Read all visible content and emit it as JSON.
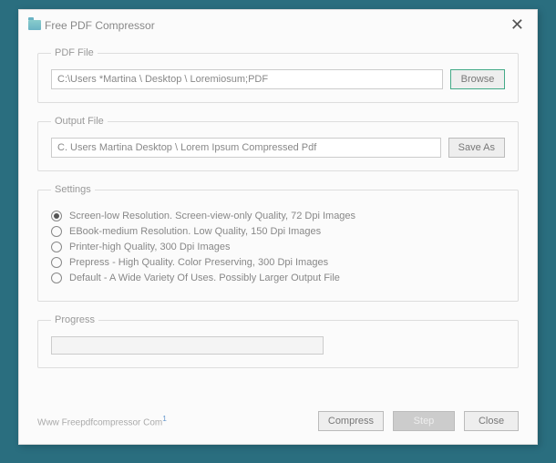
{
  "title": "Free PDF Compressor",
  "pdf_file": {
    "legend": "PDF File",
    "value": "C:\\Users *Martina \\ Desktop \\ Loremiosum;PDF",
    "browse": "Browse"
  },
  "output_file": {
    "legend": "Output File",
    "value": "C. Users Martina Desktop \\ Lorem Ipsum Compressed Pdf",
    "save_as": "Save As"
  },
  "settings": {
    "legend": "Settings",
    "options": [
      "Screen-low Resolution. Screen-view-only Quality, 72 Dpi Images",
      "EBook-medium Resolution. Low Quality, 150 Dpi Images",
      "Printer-high Quality, 300 Dpi Images",
      "Prepress - High Quality. Color Preserving, 300 Dpi Images",
      "Default - A Wide Variety Of Uses. Possibly Larger Output File"
    ],
    "selected": 0
  },
  "progress": {
    "legend": "Progress"
  },
  "footer": {
    "link": "Www Freepdfcompressor Com",
    "compress": "Compress",
    "step": "Step",
    "close": "Close"
  }
}
